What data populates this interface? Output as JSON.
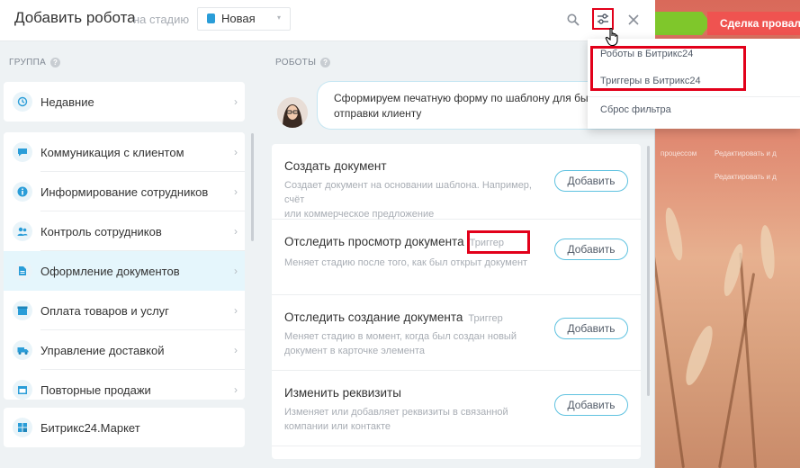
{
  "header": {
    "title": "Добавить робота",
    "stage_label": "на стадию",
    "stage_value": "Новая"
  },
  "background": {
    "stage_red": "Сделка провал",
    "text1": "процессом",
    "text2": "Редактировать и д",
    "text3": "Редактировать и д"
  },
  "filter_menu": {
    "items": [
      "Роботы в Битрикс24",
      "Триггеры в Битрикс24",
      "Сброс фильтра"
    ]
  },
  "groups": {
    "caption": "ГРУППА",
    "recent": "Недавние",
    "items": [
      {
        "label": "Коммуникация с клиентом",
        "icon": "chat-icon"
      },
      {
        "label": "Информирование сотрудников",
        "icon": "info-icon"
      },
      {
        "label": "Контроль сотрудников",
        "icon": "users-icon"
      },
      {
        "label": "Оформление документов",
        "icon": "document-icon"
      },
      {
        "label": "Оплата товаров и услуг",
        "icon": "box-icon"
      },
      {
        "label": "Управление доставкой",
        "icon": "truck-icon"
      },
      {
        "label": "Повторные продажи",
        "icon": "calendar-icon"
      }
    ],
    "market": "Битрикс24.Маркет"
  },
  "robots": {
    "caption": "РОБОТЫ",
    "tip_line1": "Сформируем печатную форму по шаблону для быстрой",
    "tip_line2": "отправки клиенту",
    "add_label": "Добавить",
    "list": [
      {
        "name": "Создать документ",
        "tag": "",
        "desc1": "Создает документ на основании шаблона. Например, счёт",
        "desc2": "или коммерческое предложение"
      },
      {
        "name": "Отследить просмотр документа",
        "tag": "Триггер",
        "desc1": "Меняет стадию после того, как был открыт документ",
        "desc2": ""
      },
      {
        "name": "Отследить создание документа",
        "tag": "Триггер",
        "desc1": "Меняет стадию в момент, когда был создан новый",
        "desc2": "документ в карточке элемента"
      },
      {
        "name": "Изменить реквизиты",
        "tag": "",
        "desc1": "Изменяет или добавляет реквизиты в связанной",
        "desc2": "компании или контакте"
      }
    ]
  },
  "colors": {
    "accent_blue": "#2a9dd8",
    "highlight_red": "#e2001a",
    "button_border": "#5fc2e0",
    "active_row": "#e5f6fc"
  }
}
